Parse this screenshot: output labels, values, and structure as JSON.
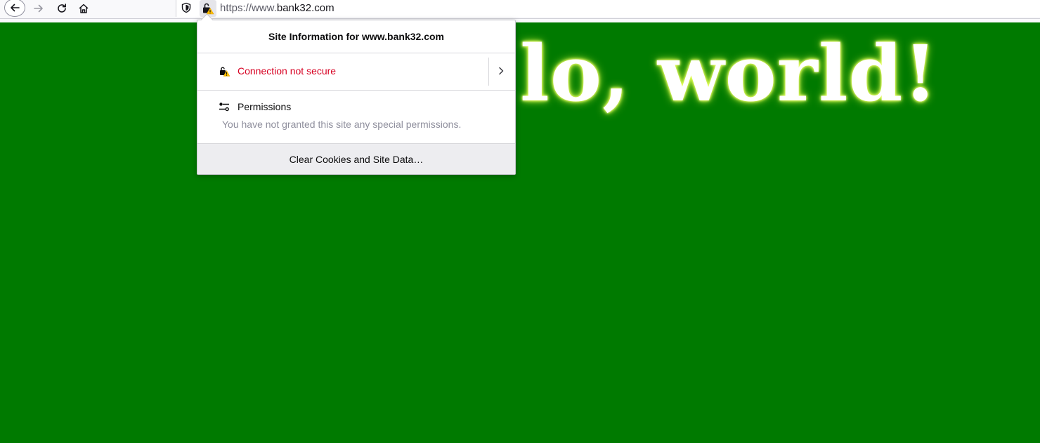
{
  "browser": {
    "url_prefix": "https://www.",
    "url_domain": "bank32.com",
    "toolbar_icons": [
      "back-icon",
      "forward-icon",
      "reload-icon",
      "home-icon",
      "tracking-shield-icon",
      "insecure-lock-icon"
    ]
  },
  "page": {
    "heading": "lo, world!",
    "background": "#007a00"
  },
  "site_info_popup": {
    "title": "Site Information for www.bank32.com",
    "connection_label": "Connection not secure",
    "connection_color": "#d70022",
    "permissions_title": "Permissions",
    "permissions_description": "You have not granted this site any special permissions.",
    "clear_button_label": "Clear Cookies and Site Data…"
  }
}
